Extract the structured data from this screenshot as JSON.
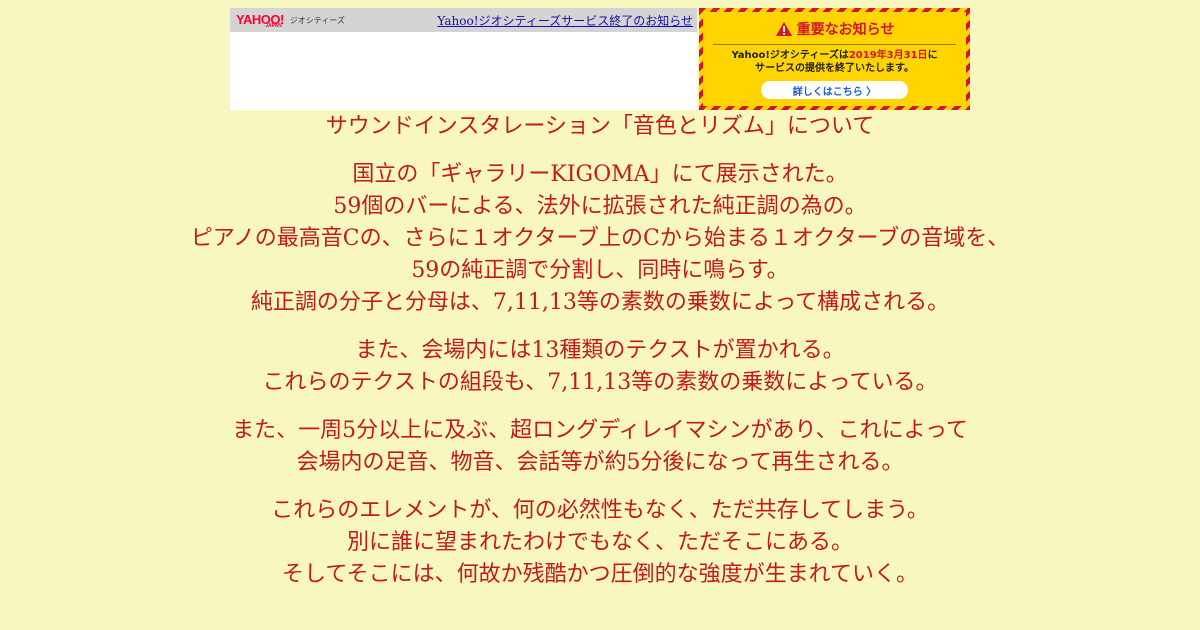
{
  "banner": {
    "logo_text": "YAHOO!",
    "logo_sub": "JAPAN",
    "service_name": "ジオシティーズ",
    "link_text": "Yahoo!ジオシティーズサービス終了のお知らせ"
  },
  "notice": {
    "title": "重要なお知らせ",
    "body_prefix": "Yahoo!ジオシティーズは",
    "body_date": "2019年3月31日",
    "body_suffix": "に",
    "body_line2": "サービスの提供を終了いたします。",
    "button_label": "詳しくはこちら 〉",
    "colors": {
      "background": "#ffd400",
      "stripe": "#d4142a"
    }
  },
  "content": {
    "title": "サウンドインスタレーション「音色とリズム」について",
    "paragraphs": [
      {
        "lines": [
          "国立の「ギャラリーKIGOMA」にて展示された。",
          "59個のバーによる、法外に拡張された純正調の為の。",
          "ピアノの最高音Cの、さらに１オクターブ上のCから始まる１オクターブの音域を、",
          "59の純正調で分割し、同時に鳴らす。",
          "純正調の分子と分母は、7,11,13等の素数の乗数によって構成される。"
        ]
      },
      {
        "lines": [
          "また、会場内には13種類のテクストが置かれる。",
          "これらのテクストの組段も、7,11,13等の素数の乗数によっている。"
        ]
      },
      {
        "lines": [
          "また、一周5分以上に及ぶ、超ロングディレイマシンがあり、これによって",
          "会場内の足音、物音、会話等が約5分後になって再生される。"
        ]
      },
      {
        "lines": [
          "これらのエレメントが、何の必然性もなく、ただ共存してしまう。",
          "別に誰に望まれたわけでもなく、ただそこにある。",
          "そしてそこには、何故か残酷かつ圧倒的な強度が生まれていく。"
        ]
      }
    ],
    "text_color": "#c41a1a",
    "background_color": "#f7f7bf"
  }
}
